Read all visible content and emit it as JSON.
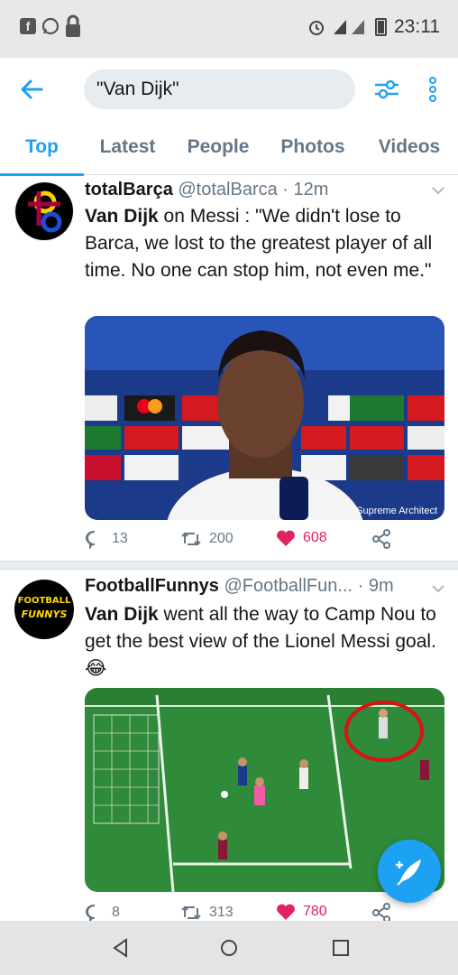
{
  "status_bar": {
    "time": "23:11",
    "battery_level": "28",
    "left_icons": [
      "facebook-icon",
      "whatsapp-icon",
      "lock-icon"
    ],
    "right_icons": [
      "alarm-icon",
      "signal-icon",
      "battery-icon"
    ]
  },
  "search": {
    "query": "\"Van Dijk\""
  },
  "tabs": [
    {
      "label": "Top",
      "active": true
    },
    {
      "label": "Latest"
    },
    {
      "label": "People"
    },
    {
      "label": "Photos"
    },
    {
      "label": "Videos"
    }
  ],
  "tweets": [
    {
      "name": "totalBarça",
      "handle": "@totalBarca",
      "time": "· 12m",
      "text_bold": "Van Dijk",
      "text_rest": " on Messi : \"We didn't lose to Barca, we lost to the greatest player of all time. No one can stop him, not even me.\"",
      "media_caption": "Supreme Architect",
      "replies": "13",
      "retweets": "200",
      "likes": "608"
    },
    {
      "name": "FootballFunnys",
      "handle": "@FootballFun...",
      "time": "· 9m",
      "text_bold": "Van Dijk",
      "text_rest": " went all the way to Camp Nou to get the best view of the Lionel Messi goal. 😂",
      "avatar_text_top": "FOOTBALL",
      "avatar_text_bottom": "FUNNYS",
      "replies": "8",
      "retweets": "313",
      "likes": "780"
    }
  ],
  "colors": {
    "accent": "#1da1f2",
    "like": "#e0245e",
    "muted": "#657786"
  }
}
